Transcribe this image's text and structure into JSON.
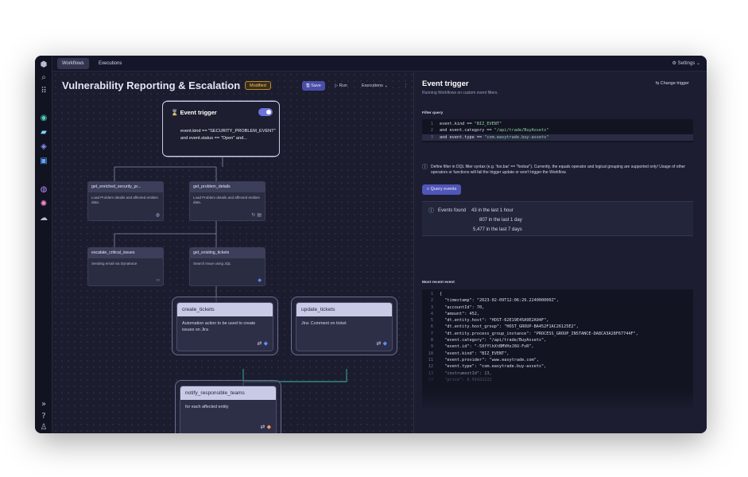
{
  "topbar": {
    "tabs": [
      "Workflows",
      "Executions"
    ],
    "settings_label": "Settings"
  },
  "workflow": {
    "title": "Vulnerability Reporting & Escalation",
    "status_badge": "Modified",
    "toolbar": {
      "save": "Save",
      "run": "Run",
      "executions": "Executions"
    }
  },
  "trigger_node": {
    "title": "Event trigger",
    "condition": "event.kind == \"SECURITY_PROBLEM_EVENT\" and event.status == \"Open\" and..."
  },
  "nodes": [
    {
      "title": "get_enriched_security_pr...",
      "desc": "Load Problem details and affected entities data."
    },
    {
      "title": "get_problem_details",
      "desc": "Load Problem details and affected entities data."
    },
    {
      "title": "escalate_critical_issues",
      "desc": "Sending email via Dynatrace"
    },
    {
      "title": "get_existing_tickets",
      "desc": "Search issue using JQL"
    },
    {
      "title": "create_tickets",
      "desc": "Automation action to be used to create issues on Jira"
    },
    {
      "title": "update_tickets",
      "desc": "Jira: Comment on ticket"
    },
    {
      "title": "notify_responsible_teams",
      "desc": "for each affected entity"
    }
  ],
  "panel": {
    "title": "Event trigger",
    "subtitle": "Running Workflows on custom event filters.",
    "change_trigger": "Change trigger",
    "filter_label": "Filter query",
    "filter_lines": [
      {
        "n": "1",
        "pre": "event.kind == ",
        "str": "\"BIZ_EVENT\""
      },
      {
        "n": "2",
        "pre": "and event.category == ",
        "str": "\"/api/trade/BuyAssets\""
      },
      {
        "n": "3",
        "pre": "and event.type == ",
        "str": "\"com.easytrade.buy-assets\""
      }
    ],
    "info_text": "Define filter in DQL filter syntax (e.g. 'foo.bar' == \"foobar\"). Currently, the equals operator and logical grouping are supported only! Usage of other operators or functions will fail the trigger update or won't trigger the Workflow.",
    "query_button": "Query events",
    "events_label": "Events found",
    "events": [
      "43 in the last 1 hour",
      "807 in the last 1 day",
      "5,477 in the last 7 days"
    ],
    "recent_label": "Most recent event",
    "recent_lines": [
      {
        "n": "1",
        "t": "{"
      },
      {
        "n": "2",
        "t": "  \"timestamp\": \"2023-02-09T12:06:29.224000000Z\","
      },
      {
        "n": "3",
        "t": "  \"accountId\": 70,"
      },
      {
        "n": "4",
        "t": "  \"amount\": 452,"
      },
      {
        "n": "5",
        "t": "  \"dt.entity.host\": \"HOST-62E19E45A9E2A94F\","
      },
      {
        "n": "6",
        "t": "  \"dt.entity.host_group\": \"HOST_GROUP-BA452F1AC26125E2\","
      },
      {
        "n": "7",
        "t": "  \"dt.entity.process_group_instance\": \"PROCESS_GROUP_INSTANCE-DA8CA3A28F67744F\","
      },
      {
        "n": "8",
        "t": "  \"event.category\": \"/api/trade/BuyAssets\","
      },
      {
        "n": "9",
        "t": "  \"event.id\": \"-5XfYlhXtBMVHzJ6U-FxR\","
      },
      {
        "n": "10",
        "t": "  \"event.kind\": \"BIZ_EVENT\","
      },
      {
        "n": "11",
        "t": "  \"event.provider\": \"www.easytrade.com\","
      },
      {
        "n": "12",
        "t": "  \"event.type\": \"com.easytrade.buy-assets\","
      },
      {
        "n": "13",
        "t": "  \"instrumentId\": 13,"
      },
      {
        "n": "14",
        "t": "  \"price\": 0.91422222"
      }
    ]
  }
}
